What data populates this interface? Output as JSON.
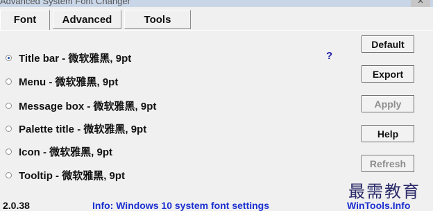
{
  "window": {
    "title": "Advanced System Font Changer",
    "close_glyph": "✕"
  },
  "tabs": [
    {
      "label": "Font",
      "active": true
    },
    {
      "label": "Advanced",
      "active": false
    },
    {
      "label": "Tools",
      "active": false
    }
  ],
  "font_items": [
    {
      "label": "Title bar - 微软雅黑, 9pt",
      "checked": true
    },
    {
      "label": "Menu - 微软雅黑, 9pt",
      "checked": false
    },
    {
      "label": "Message box - 微软雅黑, 9pt",
      "checked": false
    },
    {
      "label": "Palette title - 微软雅黑, 9pt",
      "checked": false
    },
    {
      "label": "Icon - 微软雅黑, 9pt",
      "checked": false
    },
    {
      "label": "Tooltip - 微软雅黑, 9pt",
      "checked": false
    }
  ],
  "help_link": "?",
  "buttons": {
    "default": "Default",
    "export": "Export",
    "apply": "Apply",
    "help": "Help",
    "refresh": "Refresh"
  },
  "footer": {
    "version": "2.0.38",
    "info": "Info: Windows 10 system font settings",
    "site": "WinTools.Info"
  },
  "watermark": "最需教育"
}
